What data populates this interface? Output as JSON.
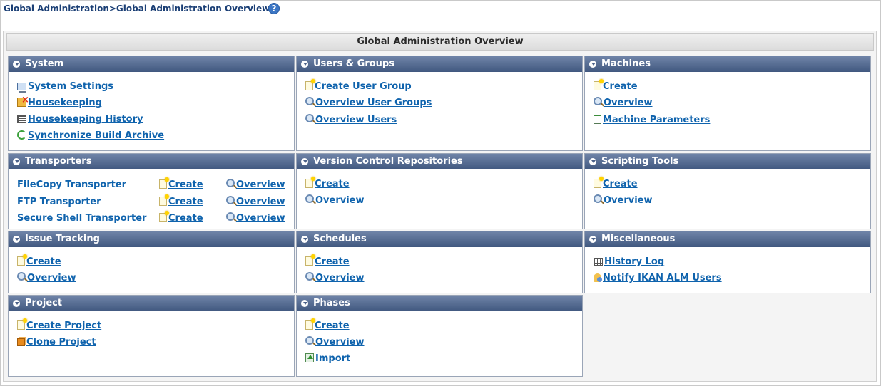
{
  "breadcrumb": "Global Administration>Global Administration Overview",
  "help_icon": "?",
  "page_title": "Global Administration Overview",
  "panels": {
    "system": {
      "title": "System",
      "items": [
        {
          "label": "System Settings",
          "icon": "monitor-icon"
        },
        {
          "label": "Housekeeping",
          "icon": "housekeeping-icon"
        },
        {
          "label": "Housekeeping History",
          "icon": "grid-icon"
        },
        {
          "label": "Synchronize Build Archive",
          "icon": "sync-icon"
        }
      ]
    },
    "users_groups": {
      "title": "Users & Groups",
      "items": [
        {
          "label": "Create User Group",
          "icon": "new-icon"
        },
        {
          "label": "Overview User Groups",
          "icon": "magnifier-icon"
        },
        {
          "label": "Overview Users",
          "icon": "magnifier-icon"
        }
      ]
    },
    "machines": {
      "title": "Machines",
      "items": [
        {
          "label": "Create",
          "icon": "new-icon"
        },
        {
          "label": "Overview",
          "icon": "magnifier-icon"
        },
        {
          "label": "Machine Parameters",
          "icon": "parameters-icon"
        }
      ]
    },
    "transporters": {
      "title": "Transporters",
      "rows": [
        {
          "name": "FileCopy Transporter",
          "create": "Create",
          "overview": "Overview"
        },
        {
          "name": "FTP Transporter",
          "create": "Create",
          "overview": "Overview"
        },
        {
          "name": "Secure Shell Transporter",
          "create": "Create",
          "overview": "Overview"
        }
      ]
    },
    "vcr": {
      "title": "Version Control Repositories",
      "items": [
        {
          "label": "Create",
          "icon": "new-icon"
        },
        {
          "label": "Overview",
          "icon": "magnifier-icon"
        }
      ]
    },
    "scripting": {
      "title": "Scripting Tools",
      "items": [
        {
          "label": "Create",
          "icon": "new-icon"
        },
        {
          "label": "Overview",
          "icon": "magnifier-icon"
        }
      ]
    },
    "issue": {
      "title": "Issue Tracking",
      "items": [
        {
          "label": "Create",
          "icon": "new-icon"
        },
        {
          "label": "Overview",
          "icon": "magnifier-icon"
        }
      ]
    },
    "schedules": {
      "title": "Schedules",
      "items": [
        {
          "label": "Create",
          "icon": "new-icon"
        },
        {
          "label": "Overview",
          "icon": "magnifier-icon"
        }
      ]
    },
    "misc": {
      "title": "Miscellaneous",
      "items": [
        {
          "label": "History Log",
          "icon": "grid-icon"
        },
        {
          "label": "Notify IKAN ALM Users",
          "icon": "notify-icon"
        }
      ]
    },
    "project": {
      "title": "Project",
      "items": [
        {
          "label": "Create Project",
          "icon": "new-icon"
        },
        {
          "label": "Clone Project",
          "icon": "clone-icon"
        }
      ]
    },
    "phases": {
      "title": "Phases",
      "items": [
        {
          "label": "Create",
          "icon": "new-icon"
        },
        {
          "label": "Overview",
          "icon": "magnifier-icon"
        },
        {
          "label": "Import",
          "icon": "import-icon"
        }
      ]
    }
  }
}
